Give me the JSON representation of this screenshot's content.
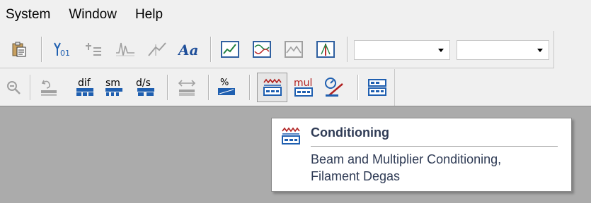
{
  "menu": {
    "items": [
      "System",
      "Window",
      "Help"
    ]
  },
  "toolbar_row1": {
    "icons": [
      "paste-icon",
      "peak-jump-icon",
      "bar-list-icon",
      "spectrum-icon",
      "angle-icon",
      "font-icon",
      "trend-chart-icon",
      "profile-chart-icon",
      "image-chart-icon",
      "bar-meter-icon"
    ],
    "combo1_value": "",
    "combo2_value": ""
  },
  "toolbar_row2": {
    "buttons": {
      "dif_label": "dif",
      "sm_label": "sm",
      "ds_label": "d/s",
      "percent_label": "%",
      "mul_label": "mul"
    }
  },
  "tooltip": {
    "title": "Conditioning",
    "description": "Beam and Multiplier Conditioning,\nFilament Degas"
  },
  "colors": {
    "accent_blue": "#1f5fb0",
    "accent_red": "#b02020",
    "disabled_gray": "#a0a0a0",
    "workspace": "#ababab"
  }
}
